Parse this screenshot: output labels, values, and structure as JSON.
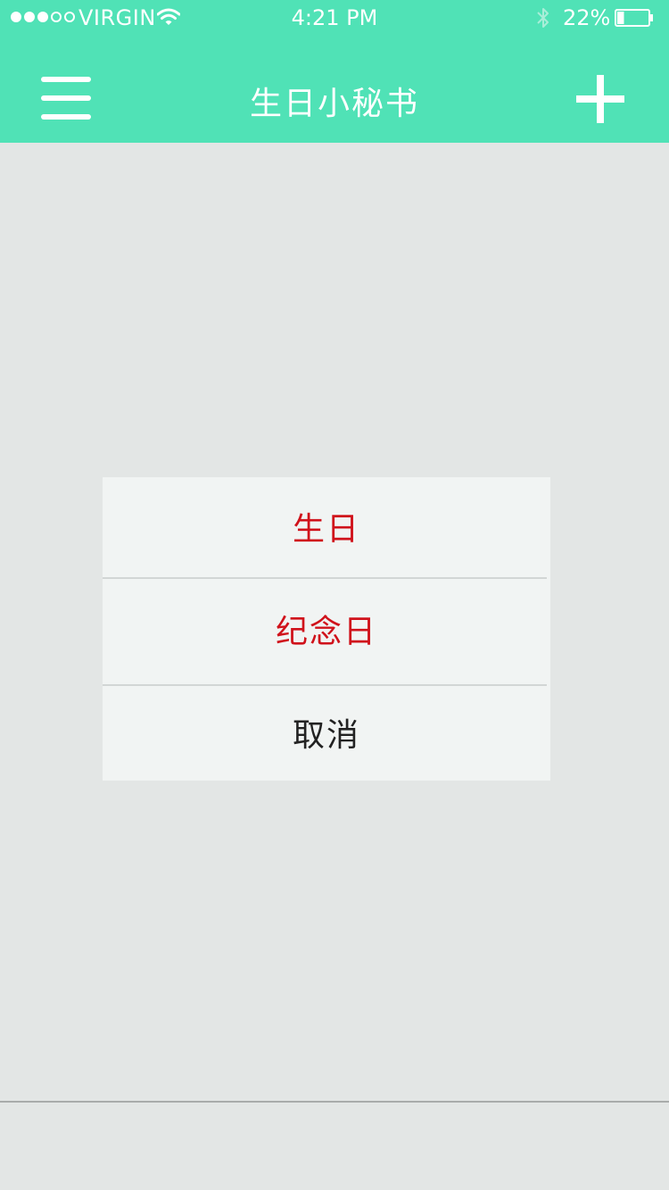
{
  "status_bar": {
    "signal_dots": [
      true,
      true,
      true,
      false,
      false
    ],
    "carrier": "VIRGIN",
    "time": "4:21 PM",
    "battery_percent": "22%",
    "battery_level": 0.22,
    "icons": [
      "wifi-icon",
      "bluetooth-icon",
      "battery-icon"
    ]
  },
  "nav": {
    "title": "生日小秘书",
    "menu_icon": "hamburger-menu-icon",
    "add_icon": "plus-icon"
  },
  "dialog": {
    "options": [
      {
        "label": "生日",
        "color": "#d0121b"
      },
      {
        "label": "纪念日",
        "color": "#d0121b"
      },
      {
        "label": "取消",
        "color": "#222222"
      }
    ]
  },
  "colors": {
    "brand": "#50e2b6",
    "background": "#e3e6e5",
    "dialog_background": "#f1f4f3",
    "accent_red": "#d0121b"
  }
}
